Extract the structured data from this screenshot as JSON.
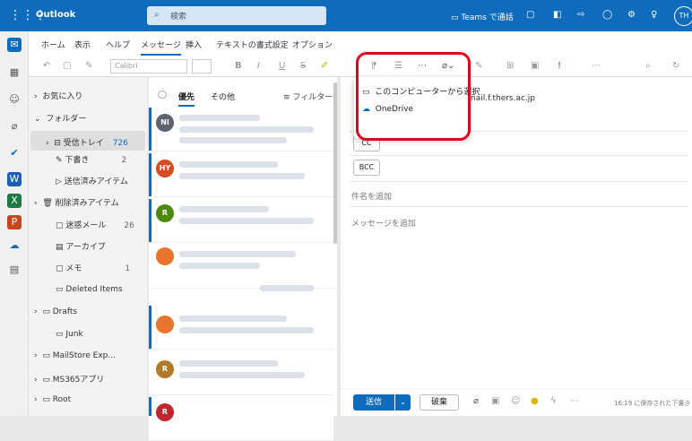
{
  "app": {
    "title": "Outlook",
    "user_initials": "TH"
  },
  "search": {
    "placeholder": "検索"
  },
  "topbar": {
    "teams_label": "Teams で通話"
  },
  "ribbon_tabs": [
    "ホーム",
    "表示",
    "ヘルプ",
    "メッセージ",
    "挿入",
    "テキストの書式設定",
    "オプション"
  ],
  "ribbon": {
    "font": "Calibri"
  },
  "folders": {
    "favorites": "お気に入り",
    "root": "フォルダー",
    "items": [
      {
        "label": "受信トレイ",
        "count": "726"
      },
      {
        "label": "下書き",
        "count": "2"
      },
      {
        "label": "送信済みアイテム",
        "count": ""
      },
      {
        "label": "削除済みアイテム",
        "count": ""
      },
      {
        "label": "迷惑メール",
        "count": "26"
      },
      {
        "label": "アーカイブ",
        "count": ""
      },
      {
        "label": "メモ",
        "count": "1"
      },
      {
        "label": "Deleted Items",
        "count": ""
      },
      {
        "label": "Drafts",
        "count": ""
      },
      {
        "label": "Junk",
        "count": ""
      },
      {
        "label": "MailStore Exp...",
        "count": ""
      },
      {
        "label": "MS365アプリ",
        "count": ""
      },
      {
        "label": "Root",
        "count": ""
      }
    ]
  },
  "list": {
    "focused_tab": "優先",
    "other_tab": "その他",
    "filter": "フィルター",
    "avatars": [
      {
        "initials": "NI",
        "color": "#5b6470"
      },
      {
        "initials": "HY",
        "color": "#d94a1e"
      },
      {
        "initials": "R",
        "color": "#4f8a10"
      },
      {
        "initials": "",
        "color": "#e8732a"
      },
      {
        "initials": "",
        "color": "#e8732a"
      },
      {
        "initials": "R",
        "color": "#b07a2a"
      },
      {
        "initials": "R",
        "color": "#c0262d"
      }
    ]
  },
  "compose": {
    "to_partial": "nail.f.thers.ac.jp",
    "cc": "CC",
    "bcc": "BCC",
    "subject_placeholder": "件名を追加",
    "body_placeholder": "メッセージを追加",
    "send": "送信",
    "discard": "破棄",
    "saved_status": "16:19 に保存された下書き"
  },
  "attach_menu": {
    "from_computer": "このコンピューターから選択",
    "onedrive": "OneDrive"
  },
  "colors": {
    "brand": "#0f6cbd",
    "highlight": "#e0001b"
  }
}
